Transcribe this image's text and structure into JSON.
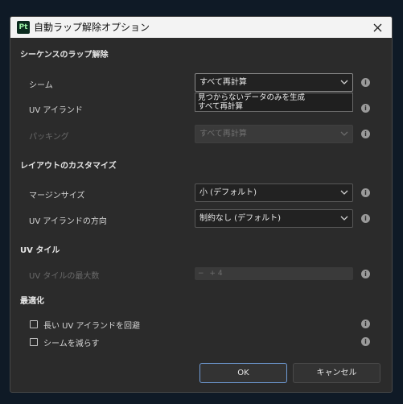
{
  "window": {
    "title": "自動ラップ解除オプション",
    "app_icon_text": "Pt"
  },
  "sections": {
    "seams": {
      "title": "シーケンスのラップ解除"
    },
    "layout": {
      "title": "レイアウトのカスタマイズ"
    },
    "uv_tiles": {
      "title": "UV タイル"
    },
    "optimization": {
      "title": "最適化"
    }
  },
  "rows": {
    "seam": {
      "label": "シーム",
      "value": "すべて再計算"
    },
    "uv_island": {
      "label": "UV アイランド"
    },
    "packing": {
      "label": "パッキング",
      "value": "すべて再計算"
    },
    "margin": {
      "label": "マージンサイズ",
      "value": "小 (デフォルト)"
    },
    "island_dir": {
      "label": "UV アイランドの方向",
      "value": "制約なし (デフォルト)"
    },
    "max_tiles": {
      "label": "UV タイルの最大数",
      "minus": "−",
      "plus": "+",
      "value": "4"
    }
  },
  "dropdown": {
    "options": [
      "見つからないデータのみを生成",
      "すべて再計算"
    ]
  },
  "checkboxes": {
    "avoid_long": {
      "label": "長い UV アイランドを回避",
      "checked": false
    },
    "reduce_seams": {
      "label": "シームを減らす",
      "checked": false
    }
  },
  "buttons": {
    "ok": "OK",
    "cancel": "キャンセル"
  },
  "colors": {
    "accent_border": "#6f9bd6",
    "titlebar": "#f3f3f3",
    "panel": "#2b2b2b"
  }
}
